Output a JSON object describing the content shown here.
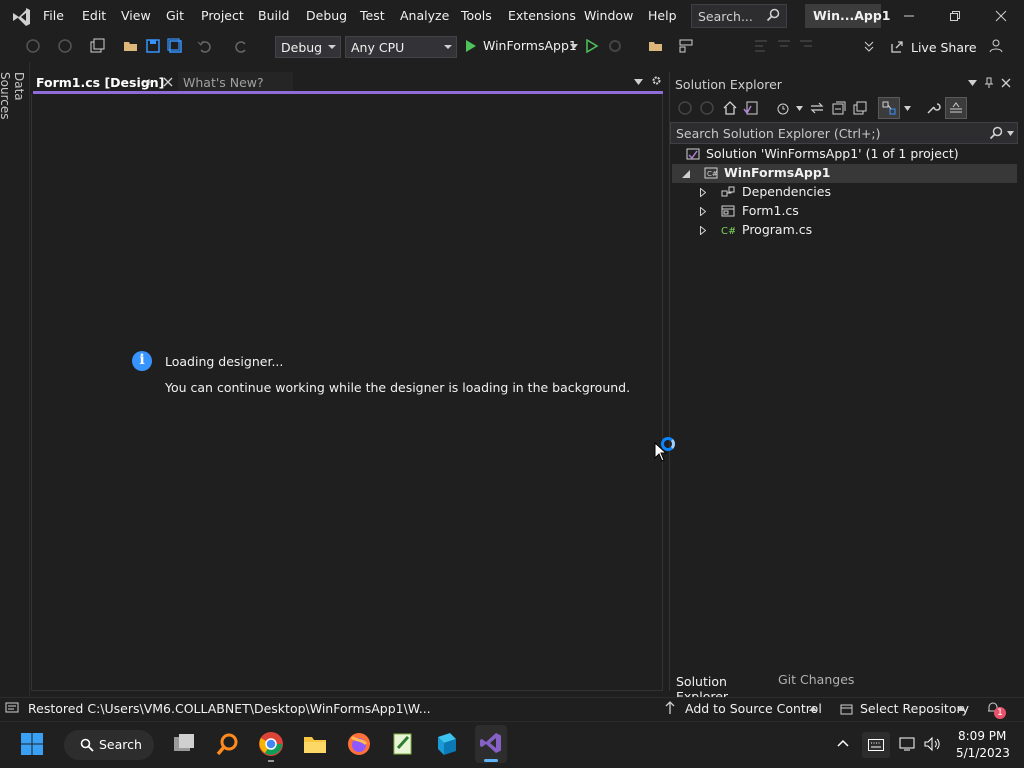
{
  "menu": {
    "items": [
      "File",
      "Edit",
      "View",
      "Git",
      "Project",
      "Build",
      "Debug",
      "Test",
      "Analyze",
      "Tools",
      "Extensions",
      "Window",
      "Help"
    ],
    "search_placeholder": "Search...",
    "solution_short": "Win...App1"
  },
  "toolbar": {
    "config": "Debug",
    "platform": "Any CPU",
    "start_target": "WinFormsApp1",
    "live_share": "Live Share"
  },
  "left_rail": {
    "data_sources": "Data Sources"
  },
  "document_tabs": {
    "active": "Form1.cs [Design]",
    "inactive": "What's New?"
  },
  "editor": {
    "loading_title": "Loading designer...",
    "loading_message": "You can continue working while the designer is loading in the background."
  },
  "solution_explorer": {
    "title": "Solution Explorer",
    "search_placeholder": "Search Solution Explorer (Ctrl+;)",
    "solution": "Solution 'WinFormsApp1' (1 of 1 project)",
    "project": "WinFormsApp1",
    "items": [
      "Dependencies",
      "Form1.cs",
      "Program.cs"
    ],
    "bottom_tabs": [
      "Solution Explorer",
      "Git Changes"
    ]
  },
  "status": {
    "message": "Restored C:\\Users\\VM6.COLLABNET\\Desktop\\WinFormsApp1\\W...",
    "add_to_source": "Add to Source Control",
    "select_repo": "Select Repository",
    "notification_count": "1"
  },
  "taskbar": {
    "search_label": "Search",
    "time": "8:09 PM",
    "date": "5/1/2023"
  },
  "colors": {
    "accent": "#8f6cd8",
    "info_blue": "#3794ff",
    "background": "#1f1f1f"
  }
}
